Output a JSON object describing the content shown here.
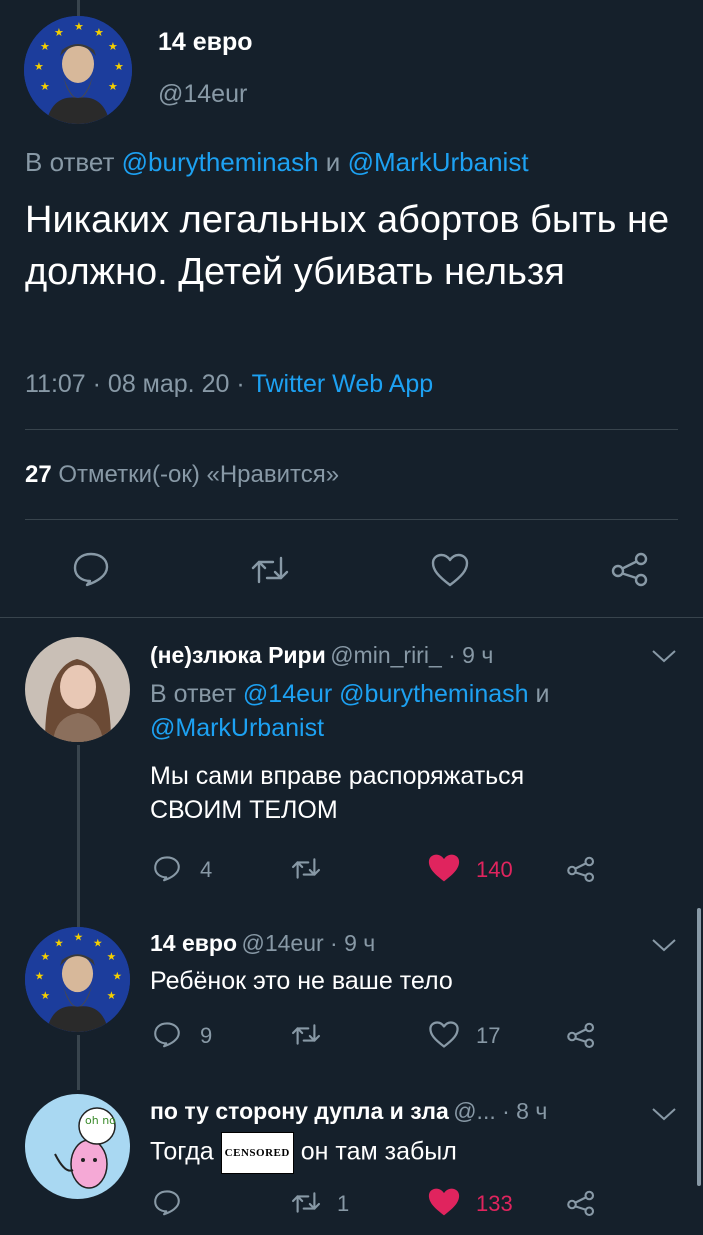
{
  "main": {
    "author_name": "14 евро",
    "author_handle": "@14eur",
    "reply_prefix": "В ответ",
    "reply_user1": "@burytheminash",
    "reply_and": "и",
    "reply_user2": "@MarkUrbanist",
    "text": "Никаких легальных абортов быть не должно. Детей убивать нельзя",
    "time": "11:07 · 08 мар. 20 ·",
    "source": "Twitter Web App",
    "likes_count": "27",
    "likes_label": "Отметки(-ок) «Нравится»"
  },
  "replies": [
    {
      "name": "(не)злюка Рири",
      "handle_time": "@min_riri_ · 9 ч",
      "reply_prefix": "В ответ",
      "reply_users": "@14eur @burytheminash",
      "reply_and": "и",
      "reply_user_last": "@MarkUrbanist",
      "text_line1": "Мы сами вправе распоряжаться",
      "text_line2": "СВОИМ ТЕЛОМ",
      "reply_count": "4",
      "like_count": "140"
    },
    {
      "name": "14 евро",
      "handle_time": "@14eur · 9 ч",
      "text": "Ребёнок это не ваше тело",
      "reply_count": "9",
      "like_count": "17"
    },
    {
      "name": "по ту сторону дупла и зла",
      "handle_time": "@... · 8 ч",
      "text_before": "Тогда",
      "censor_label": "CENSORED",
      "text_after": "он там забыл",
      "retweet_count": "1",
      "like_count": "133",
      "avatar_text": "oh no"
    }
  ],
  "colors": {
    "background": "#15202b",
    "secondary_text": "#8899a6",
    "link": "#1da1f2",
    "like_active": "#e0245e",
    "divider": "#38444d"
  }
}
